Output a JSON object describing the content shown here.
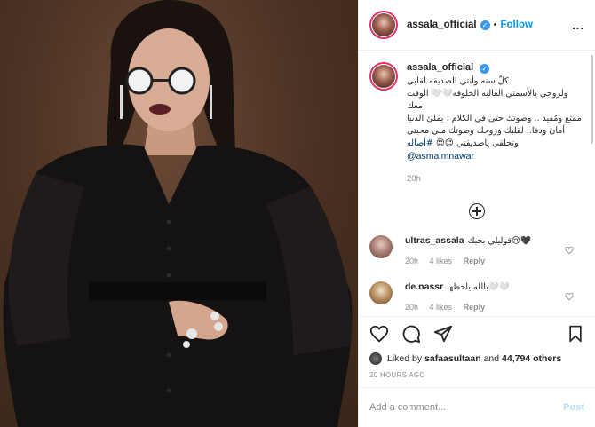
{
  "header": {
    "username": "assala_official",
    "separator": "•",
    "follow_label": "Follow",
    "more_label": "..."
  },
  "caption": {
    "username": "assala_official",
    "text_line1": "كلّ سنه وأنتي الصديقه لقلبي",
    "text_line2": "ولروحي يالأسمتي الغاليه الخلوقه🤍🤍 الوقت معك",
    "text_line3": "ممتع ومُفيد .. وصوتك حتى في الكلام ، يملئ الدنيا",
    "text_line4": "أمان ودفا.. لقلبك وروحك وصوتك مني محبتي",
    "text_line5": "وتحلقي ياصديقتي 😍😍",
    "hashtag": "#أصاله",
    "mention": "@asmalmnawar",
    "time": "20h"
  },
  "comments": [
    {
      "username": "ultras_assala",
      "text": "قوليلي بحبك😢🖤",
      "time": "20h",
      "likes": "4 likes",
      "reply": "Reply"
    },
    {
      "username": "de.nassr",
      "text": "بالله ياحظها🤍🤍",
      "time": "20h",
      "likes": "4 likes",
      "reply": "Reply"
    }
  ],
  "likes": {
    "prefix": "Liked by",
    "user": "safaasultaan",
    "middle": "and",
    "others": "44,794 others"
  },
  "timestamp": "20 HOURS AGO",
  "add_comment": {
    "placeholder": "Add a comment...",
    "post_label": "Post"
  },
  "colors": {
    "accent": "#0095f6",
    "verified": "#3897f0",
    "post_disabled": "#b2dffc",
    "muted": "#8e8e8e"
  },
  "icons": [
    "verified-badge-icon",
    "more-icon",
    "add-circle-icon",
    "heart-icon",
    "comment-icon",
    "share-icon",
    "bookmark-icon"
  ]
}
